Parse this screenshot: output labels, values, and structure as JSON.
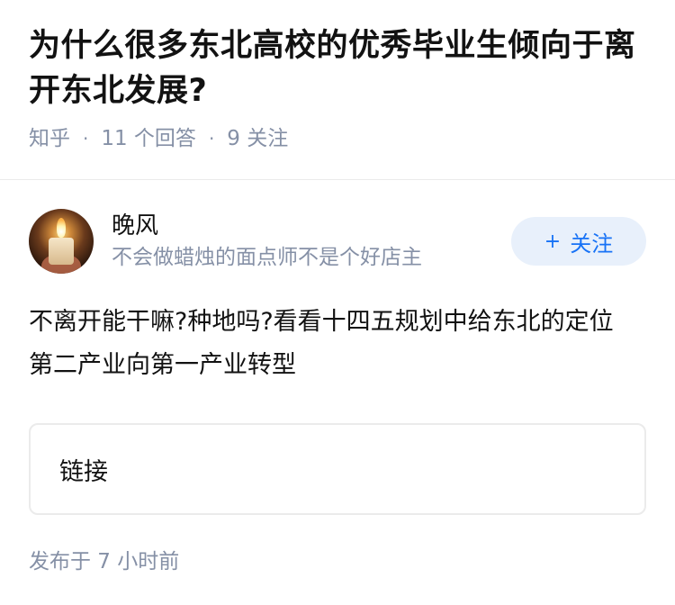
{
  "question": {
    "title": "为什么很多东北高校的优秀毕业生倾向于离开东北发展?",
    "source": "知乎",
    "separator": "·",
    "answer_count": "11 个回答",
    "follower_count": "9 关注"
  },
  "answer": {
    "author": {
      "name": "晚风",
      "headline": "不会做蜡烛的面点师不是个好店主",
      "avatar_icon": "candle-avatar"
    },
    "follow_button": {
      "icon": "+",
      "label": "关注",
      "accent_color": "#1772f6",
      "background_color": "#e8f0fb"
    },
    "content": "不离开能干嘛?种地吗?看看十四五规划中给东北的定位    第二产业向第一产业转型",
    "link_card": {
      "label": "链接"
    },
    "published": "发布于 7 小时前"
  },
  "colors": {
    "meta_text": "#8590a6",
    "primary_text": "#121212",
    "divider": "#ebebeb"
  }
}
